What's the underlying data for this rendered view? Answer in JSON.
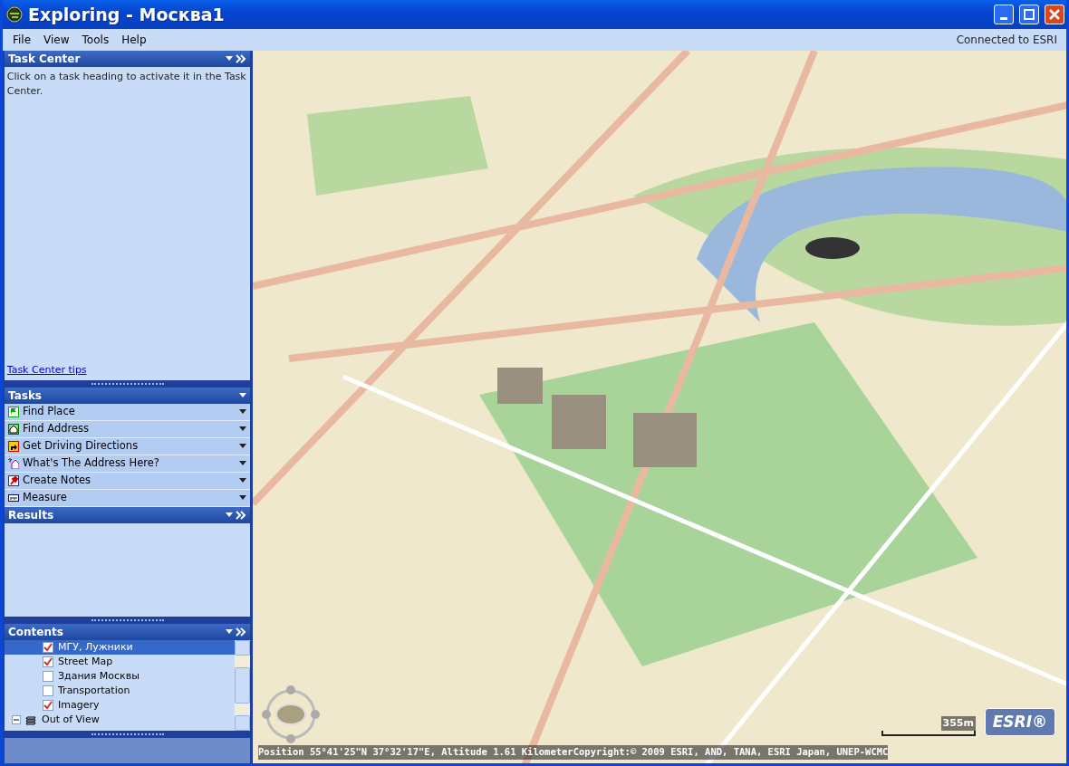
{
  "window": {
    "title": "Exploring - Москва1"
  },
  "menu": [
    "File",
    "View",
    "Tools",
    "Help"
  ],
  "connection_status": "Connected to ESRI",
  "task_center": {
    "title": "Task Center",
    "text": "Click on a task heading to activate it in the Task Center.",
    "link": "Task Center tips"
  },
  "tasks": {
    "title": "Tasks",
    "items": [
      {
        "label": "Find Place"
      },
      {
        "label": "Find Address"
      },
      {
        "label": "Get Driving Directions"
      },
      {
        "label": "What's The Address Here?"
      },
      {
        "label": "Create Notes"
      },
      {
        "label": "Measure"
      }
    ]
  },
  "results": {
    "title": "Results"
  },
  "contents": {
    "title": "Contents",
    "items": [
      {
        "kind": "layer",
        "label": "МГУ, Лужники",
        "checked": true,
        "selected": true
      },
      {
        "kind": "layer",
        "label": "Street Map",
        "checked": true,
        "selected": false
      },
      {
        "kind": "layer",
        "label": "Здания Москвы",
        "checked": false,
        "selected": false
      },
      {
        "kind": "layer",
        "label": "Transportation",
        "checked": false,
        "selected": false
      },
      {
        "kind": "layer",
        "label": "Imagery",
        "checked": true,
        "selected": false
      },
      {
        "kind": "group",
        "label": "Out of View",
        "expanded": true,
        "selected": false
      }
    ]
  },
  "map": {
    "scale": "355m",
    "logo": "ESRI®",
    "position": "Position 55°41'25\"N  37°32'17\"E, Altitude  1.61 Kilometer",
    "copyright": "Copyright:© 2009 ESRI, AND, TANA, ESRI Japan, UNEP-WCMC"
  }
}
